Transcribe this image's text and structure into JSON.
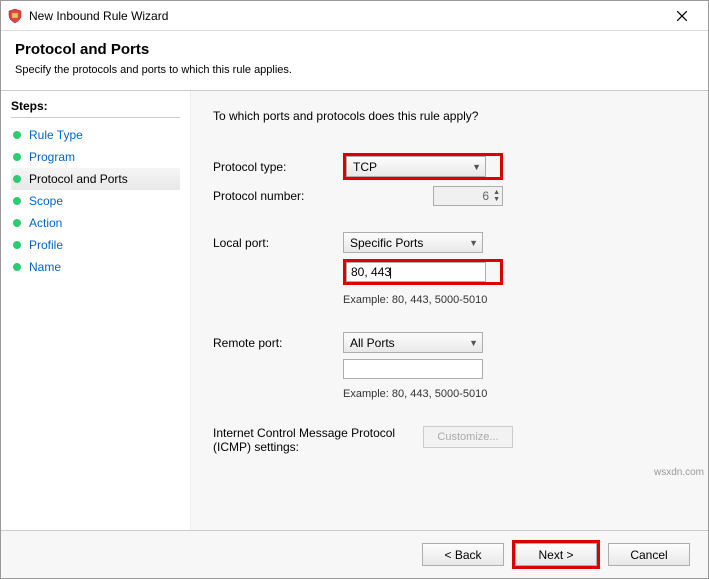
{
  "window": {
    "title": "New Inbound Rule Wizard"
  },
  "header": {
    "title": "Protocol and Ports",
    "subtitle": "Specify the protocols and ports to which this rule applies."
  },
  "sidebar": {
    "title": "Steps:",
    "items": [
      {
        "label": "Rule Type",
        "active": false
      },
      {
        "label": "Program",
        "active": false
      },
      {
        "label": "Protocol and Ports",
        "active": true
      },
      {
        "label": "Scope",
        "active": false
      },
      {
        "label": "Action",
        "active": false
      },
      {
        "label": "Profile",
        "active": false
      },
      {
        "label": "Name",
        "active": false
      }
    ]
  },
  "main": {
    "question": "To which ports and protocols does this rule apply?",
    "protocol_type_label": "Protocol type:",
    "protocol_type_value": "TCP",
    "protocol_number_label": "Protocol number:",
    "protocol_number_value": "6",
    "local_port_label": "Local port:",
    "local_port_mode": "Specific Ports",
    "local_port_value": "80, 443",
    "local_port_example": "Example: 80, 443, 5000-5010",
    "remote_port_label": "Remote port:",
    "remote_port_mode": "All Ports",
    "remote_port_value": "",
    "remote_port_example": "Example: 80, 443, 5000-5010",
    "icmp_label": "Internet Control Message Protocol (ICMP) settings:",
    "customize_label": "Customize..."
  },
  "footer": {
    "back": "< Back",
    "next": "Next >",
    "cancel": "Cancel"
  },
  "watermark": "wsxdn.com"
}
